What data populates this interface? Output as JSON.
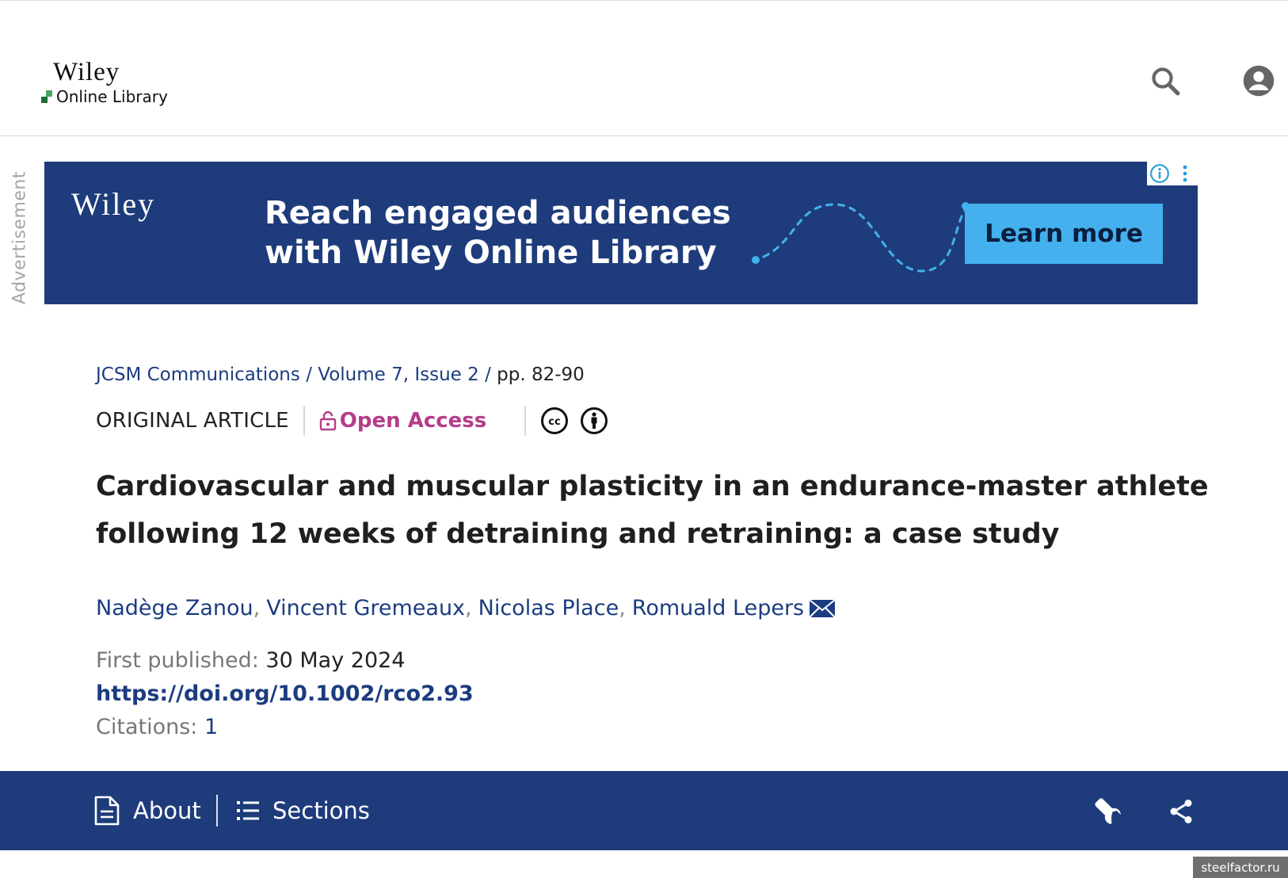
{
  "header": {
    "logo_brand": "Wiley",
    "logo_sub": "Online Library",
    "search_icon": "search-icon",
    "account_icon": "account-icon"
  },
  "ad": {
    "label": "Advertisement",
    "brand": "Wiley",
    "headline_line1": "Reach engaged audiences",
    "headline_line2": "with Wiley Online Library",
    "cta": "Learn more",
    "bg_color": "#1e3c7b",
    "cta_color": "#44b0ee"
  },
  "article": {
    "breadcrumb": {
      "journal": "JCSM Communications",
      "issue": "Volume 7, Issue 2",
      "pages": "pp. 82-90"
    },
    "type": "ORIGINAL ARTICLE",
    "access": "Open Access",
    "license_icons": [
      "cc-icon",
      "cc-by-icon"
    ],
    "title": "Cardiovascular and muscular plasticity in an endurance-master athlete following 12 weeks of detraining and retraining: a case study",
    "authors": [
      "Nadège Zanou",
      "Vincent Gremeaux",
      "Nicolas Place",
      "Romuald Lepers"
    ],
    "first_published_label": "First published:",
    "first_published": "30 May 2024",
    "doi": "https://doi.org/10.1002/rco2.93",
    "citations_label": "Citations:",
    "citations": "1"
  },
  "toolbar": {
    "about": "About",
    "sections": "Sections",
    "tools_icon": "wrench-icon",
    "share_icon": "share-icon",
    "bg_color": "#1e3c7b"
  },
  "watermark": "steelfactor.ru"
}
